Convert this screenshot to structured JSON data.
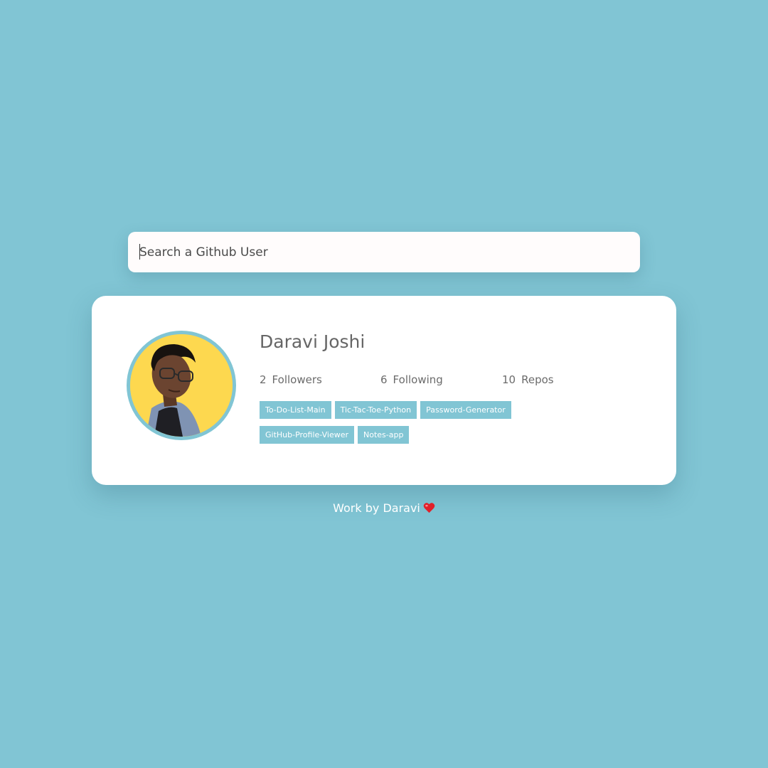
{
  "search": {
    "placeholder": "Search a Github User",
    "value": ""
  },
  "profile": {
    "name": "Daravi Joshi",
    "avatar": "user-avatar-photo",
    "stats": {
      "followers": {
        "count": "2",
        "label": "Followers"
      },
      "following": {
        "count": "6",
        "label": "Following"
      },
      "repos": {
        "count": "10",
        "label": "Repos"
      }
    },
    "repos": [
      "To-Do-List-Main",
      "Tic-Tac-Toe-Python",
      "Password-Generator",
      "GitHub-Profile-Viewer",
      "Notes-app"
    ]
  },
  "footer": {
    "text": "Work by Daravi",
    "icon": "heart-icon"
  },
  "colors": {
    "background": "#81c5d4",
    "card": "#ffffff",
    "accent": "#81c5d4",
    "avatar_bg": "#fdd84f",
    "text": "#666666"
  }
}
